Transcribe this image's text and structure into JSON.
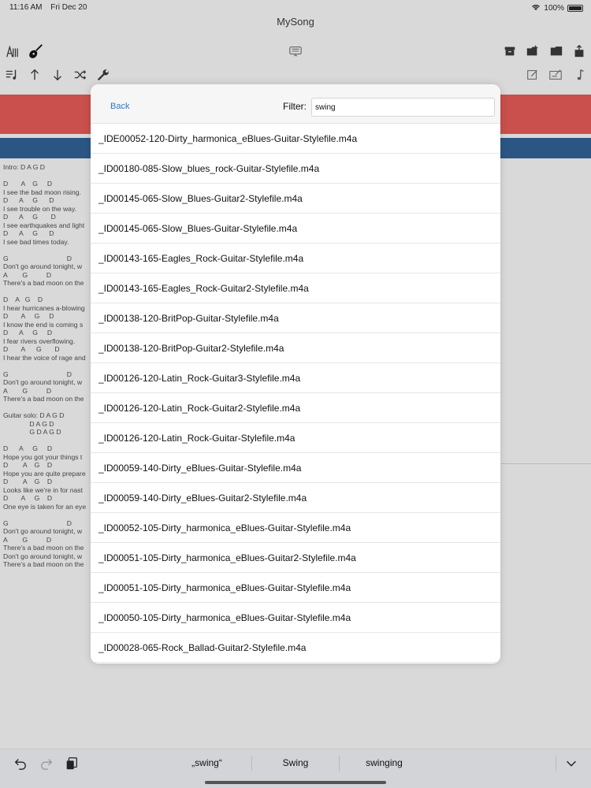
{
  "status_bar": {
    "time": "11:16 AM",
    "date": "Fri Dec 20",
    "battery": "100%"
  },
  "app_title": "MySong",
  "lyrics_text": "Intro: D A G D\n\nD       A    G     D\nI see the bad moon rising.\nD      A     G      D\nI see trouble on the way.\nD      A     G       D\nI see earthquakes and light\nD      A     G      D\nI see bad times today.\n\nG                               D\nDon't go around tonight, w\nA        G          D\nThere's a bad moon on the\n\nD    A   G    D\nI hear hurricanes a-blowing\nD       A     G     D\nI know the end is coming s\nD      A     G     D\nI fear rivers overflowing.\nD       A      G       D\nI hear the voice of rage and\n\nG                               D\nDon't go around tonight, w\nA        G          D\nThere's a bad moon on the\n\nGuitar solo: D A G D\n              D A G D\n              G D A G D\n\nD      A     G     D\nHope you got your things t\nD        A    G    D\nHope you are quite prepare\nD        A    G    D\nLooks like we're in for nast\nD       A     G    D\nOne eye is taken for an eye\n\nG                               D\nDon't go around tonight, w\nA        G          D\nThere's a bad moon on the\nDon't go around tonight, w\nThere's a bad moon on the",
  "modal": {
    "back_label": "Back",
    "filter_label": "Filter:",
    "filter_value": "swing",
    "files": [
      "_IDE00052-120-Dirty_harmonica_eBlues-Guitar-Stylefile.m4a",
      "_ID00180-085-Slow_blues_rock-Guitar-Stylefile.m4a",
      "_ID00145-065-Slow_Blues-Guitar2-Stylefile.m4a",
      "_ID00145-065-Slow_Blues-Guitar-Stylefile.m4a",
      "_ID00143-165-Eagles_Rock-Guitar-Stylefile.m4a",
      "_ID00143-165-Eagles_Rock-Guitar2-Stylefile.m4a",
      "_ID00138-120-BritPop-Guitar-Stylefile.m4a",
      "_ID00138-120-BritPop-Guitar2-Stylefile.m4a",
      "_ID00126-120-Latin_Rock-Guitar3-Stylefile.m4a",
      "_ID00126-120-Latin_Rock-Guitar2-Stylefile.m4a",
      "_ID00126-120-Latin_Rock-Guitar-Stylefile.m4a",
      "_ID00059-140-Dirty_eBlues-Guitar-Stylefile.m4a",
      "_ID00059-140-Dirty_eBlues-Guitar2-Stylefile.m4a",
      "_ID00052-105-Dirty_harmonica_eBlues-Guitar-Stylefile.m4a",
      "_ID00051-105-Dirty_harmonica_eBlues-Guitar2-Stylefile.m4a",
      "_ID00051-105-Dirty_harmonica_eBlues-Guitar-Stylefile.m4a",
      "_ID00050-105-Dirty_harmonica_eBlues-Guitar-Stylefile.m4a",
      "_ID00028-065-Rock_Ballad-Guitar2-Stylefile.m4a"
    ]
  },
  "keyboard_bar": {
    "suggestions": [
      "„swing“",
      "Swing",
      "swinging"
    ]
  },
  "colors": {
    "accent": "#3478c6",
    "red_band": "#c9504c",
    "blue_band": "#2b5684"
  }
}
